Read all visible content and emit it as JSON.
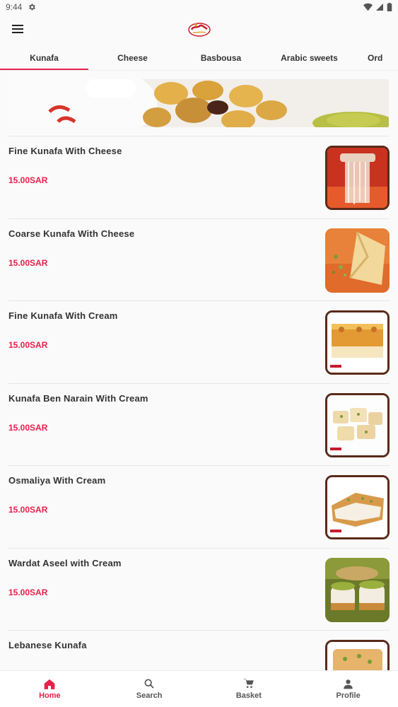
{
  "status": {
    "time": "9:44"
  },
  "colors": {
    "accent": "#e8204a",
    "text": "#333333",
    "background": "#fafafa"
  },
  "tabs": [
    {
      "label": "Kunafa",
      "active": true
    },
    {
      "label": "Cheese"
    },
    {
      "label": "Basbousa"
    },
    {
      "label": "Arabic sweets"
    },
    {
      "label": "Ord"
    }
  ],
  "products": [
    {
      "name": "Fine Kunafa With Cheese",
      "price": "15.00SAR"
    },
    {
      "name": "Coarse Kunafa With Cheese",
      "price": "15.00SAR"
    },
    {
      "name": "Fine Kunafa With Cream",
      "price": "15.00SAR"
    },
    {
      "name": "Kunafa Ben Narain With Cream",
      "price": "15.00SAR"
    },
    {
      "name": "Osmaliya With Cream",
      "price": "15.00SAR"
    },
    {
      "name": "Wardat Aseel with Cream",
      "price": "15.00SAR"
    },
    {
      "name": "Lebanese Kunafa",
      "price": ""
    }
  ],
  "nav": [
    {
      "label": "Home",
      "icon": "home-icon",
      "active": true
    },
    {
      "label": "Search",
      "icon": "search-icon"
    },
    {
      "label": "Basket",
      "icon": "cart-icon"
    },
    {
      "label": "Profile",
      "icon": "profile-icon"
    }
  ]
}
